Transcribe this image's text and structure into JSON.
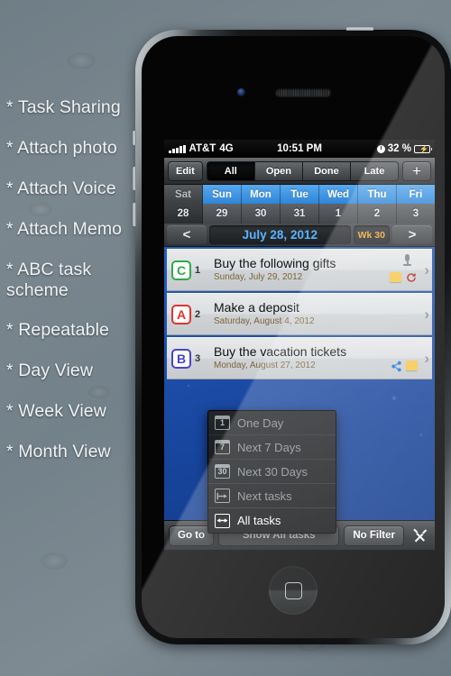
{
  "features": [
    "* Task Sharing",
    "* Attach photo",
    "* Attach Voice",
    "* Attach Memo",
    "* ABC task scheme",
    "* Repeatable",
    "* Day View",
    "* Week View",
    "* Month View"
  ],
  "status_bar": {
    "carrier": "AT&T",
    "network": "4G",
    "time": "10:51 PM",
    "battery_percent": "32 %",
    "signal_icon": "signal-bars-icon",
    "alarm_icon": "alarm-clock-icon",
    "battery_icon": "battery-charging-icon"
  },
  "toolbar": {
    "edit_label": "Edit",
    "add_label": "+",
    "segments": [
      {
        "label": "All",
        "active": true
      },
      {
        "label": "Open",
        "active": false
      },
      {
        "label": "Done",
        "active": false
      },
      {
        "label": "Late",
        "active": false
      }
    ]
  },
  "week_strip": {
    "days": [
      {
        "name": "Sat",
        "number": "28",
        "selected": true
      },
      {
        "name": "Sun",
        "number": "29",
        "selected": false
      },
      {
        "name": "Mon",
        "number": "30",
        "selected": false
      },
      {
        "name": "Tue",
        "number": "31",
        "selected": false
      },
      {
        "name": "Wed",
        "number": "1",
        "selected": false
      },
      {
        "name": "Thu",
        "number": "2",
        "selected": false
      },
      {
        "name": "Fri",
        "number": "3",
        "selected": false
      }
    ]
  },
  "month_nav": {
    "prev_label": "<",
    "title": "July 28, 2012",
    "week_badge": "Wk 30",
    "next_label": ">"
  },
  "tasks": [
    {
      "priority": "C",
      "priority_color": "#2faa4a",
      "index": "1",
      "title": "Buy the following gifts",
      "date": "Sunday, July 29, 2012",
      "icons": [
        "microphone-icon",
        "note-icon",
        "repeat-icon"
      ]
    },
    {
      "priority": "A",
      "priority_color": "#e0342f",
      "index": "2",
      "title": "Make a deposit",
      "date": "Saturday, August 4, 2012",
      "icons": []
    },
    {
      "priority": "B",
      "priority_color": "#4a44c9",
      "index": "3",
      "title": "Buy the vacation tickets",
      "date": "Monday, August 27, 2012",
      "icons": [
        "share-icon",
        "note-icon"
      ]
    }
  ],
  "menu": {
    "items": [
      {
        "label": "One Day",
        "icon_text": "1",
        "icon": "calendar-1-icon",
        "selected": false
      },
      {
        "label": "Next 7 Days",
        "icon_text": "7",
        "icon": "calendar-7-icon",
        "selected": false
      },
      {
        "label": "Next 30 Days",
        "icon_text": "30",
        "icon": "calendar-30-icon",
        "selected": false
      },
      {
        "label": "Next tasks",
        "icon_text": "→",
        "icon": "arrow-right-icon",
        "selected": false
      },
      {
        "label": "All tasks",
        "icon_text": "↔",
        "icon": "arrow-both-icon",
        "selected": true
      }
    ]
  },
  "bottom_bar": {
    "goto_label": "Go to",
    "show_label": "Show All tasks",
    "filter_label": "No Filter",
    "tools_icon": "tools-icon"
  },
  "device": {
    "home_button": "home-button",
    "earpiece": "earpiece-speaker",
    "camera": "front-camera"
  },
  "colors": {
    "accent_blue": "#5ab4ff",
    "week_badge": "#f0a830",
    "weekday_blue": "#2f86d8",
    "task_date": "#7c6338"
  }
}
